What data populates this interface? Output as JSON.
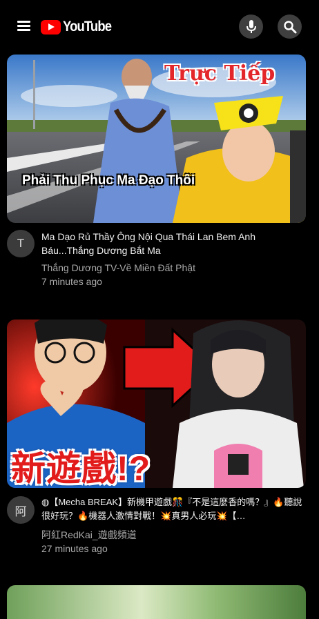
{
  "header": {
    "logo_text": "YouTube",
    "icons": [
      "menu-icon",
      "mic-icon",
      "search-icon"
    ]
  },
  "videos": [
    {
      "thumbnail_overlay_top": "Trực Tiếp",
      "thumbnail_overlay_caption": "Phải Thu Phục Ma Đạo Thôi",
      "avatar_letter": "T",
      "title": "Ma Dạo Rủ Thầy Ông Nội Qua Thái Lan Bem Anh Báu...Thắng Dương Bắt Ma",
      "channel": "Thắng Dương TV-Về Miền Đất Phật",
      "time": "7 minutes ago"
    },
    {
      "thumbnail_overlay_caption": "新遊戲!?",
      "avatar_letter": "阿",
      "title": "◍【Mecha BREAK】新機甲遊戲🎊『不是這麼香的嗎？』🔥聽說很好玩？🔥機器人激情對戰！💥真男人必玩💥【…",
      "channel": "阿紅RedKai_遊戲頻道",
      "time": "27 minutes ago"
    }
  ],
  "colors": {
    "background": "#000000",
    "brand_red": "#ff0000",
    "secondary_text": "#aaaaaa"
  }
}
